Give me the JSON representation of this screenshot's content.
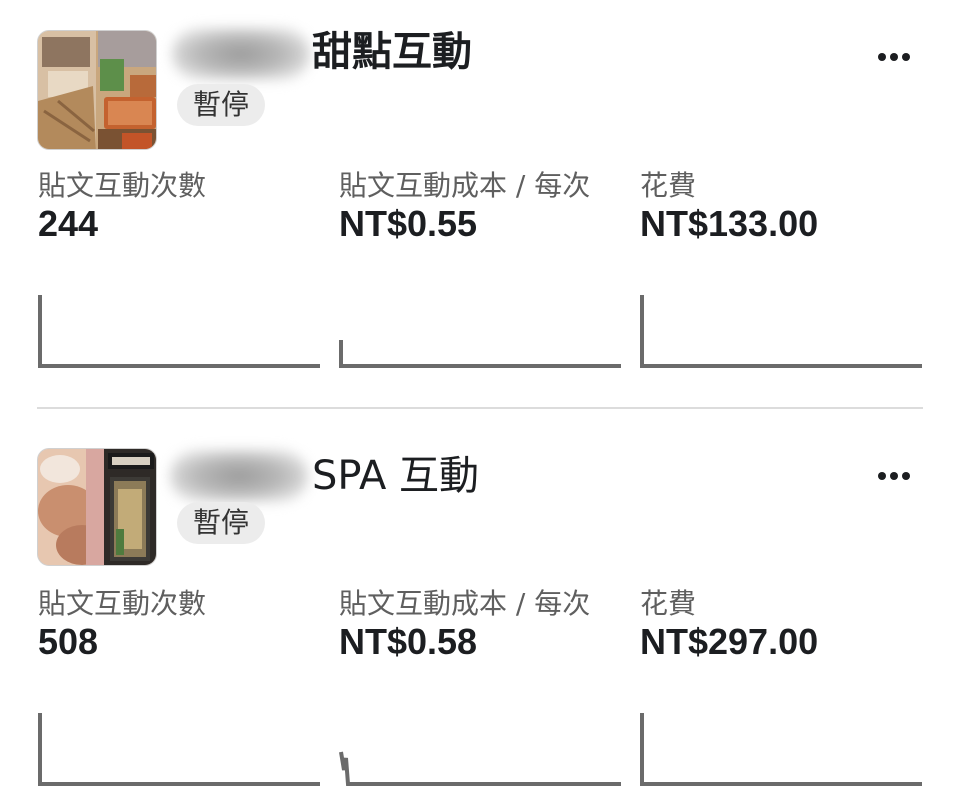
{
  "campaigns": [
    {
      "name": "甜點互動",
      "status": "暫停",
      "metrics": [
        {
          "label": "貼文互動次數",
          "value": "244"
        },
        {
          "label": "貼文互動成本 / 每次",
          "value": "NT$0.55"
        },
        {
          "label": "花費",
          "value": "NT$133.00"
        }
      ]
    },
    {
      "name": "SPA 互動",
      "status": "暫停",
      "metrics": [
        {
          "label": "貼文互動次數",
          "value": "508"
        },
        {
          "label": "貼文互動成本 / 每次",
          "value": "NT$0.58"
        },
        {
          "label": "花費",
          "value": "NT$297.00"
        }
      ]
    }
  ],
  "icons": {
    "more": "more-horizontal-icon"
  },
  "colors": {
    "text": "#1c1e21",
    "label": "#5f5f5f",
    "status_bg": "#ececec",
    "sparkline": "#6b6b6b",
    "divider": "#dcdcdc"
  }
}
